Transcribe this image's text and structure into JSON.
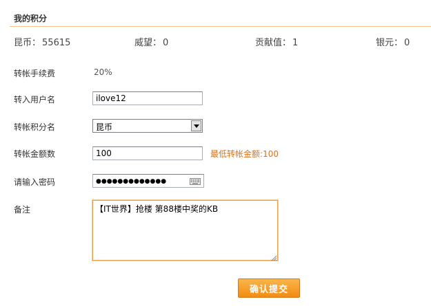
{
  "section": {
    "title": "我的积分"
  },
  "stats": [
    {
      "label": "昆币",
      "value": "55615"
    },
    {
      "label": "威望",
      "value": "0"
    },
    {
      "label": "贡献值",
      "value": "1"
    },
    {
      "label": "银元",
      "value": "0"
    }
  ],
  "form": {
    "fee": {
      "label": "转帐手续费",
      "value": "20%"
    },
    "username": {
      "label": "转入用户名",
      "value": "ilove12"
    },
    "points_type": {
      "label": "转帐积分名",
      "selected": "昆币"
    },
    "amount": {
      "label": "转帐金额数",
      "value": "100",
      "hint": "最低转帐金额:100"
    },
    "password": {
      "label": "请输入密码",
      "masked_value": "●●●●●●●●●●●●●"
    },
    "note": {
      "label": "备注",
      "value": "【IT世界】抢楼 第88楼中奖的KB"
    },
    "submit_label": "确认提交"
  },
  "colors": {
    "accent": "#f18c12",
    "hint": "#d4721b",
    "divider": "#f0c38e"
  },
  "icons": {
    "select_arrow": "dropdown-arrow-icon",
    "keyboard": "keyboard-icon",
    "resize": "resize-grip-icon"
  }
}
